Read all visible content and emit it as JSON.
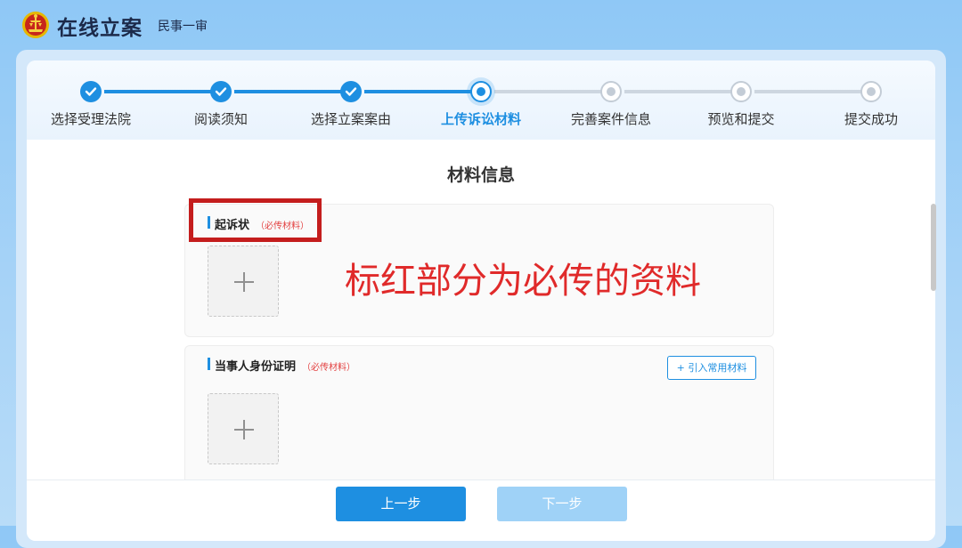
{
  "header": {
    "title": "在线立案",
    "subtitle": "民事一审",
    "emblem_icon": "court-emblem-icon"
  },
  "steps": [
    {
      "label": "选择受理法院",
      "state": "done"
    },
    {
      "label": "阅读须知",
      "state": "done"
    },
    {
      "label": "选择立案案由",
      "state": "done"
    },
    {
      "label": "上传诉讼材料",
      "state": "current"
    },
    {
      "label": "完善案件信息",
      "state": "todo"
    },
    {
      "label": "预览和提交",
      "state": "todo"
    },
    {
      "label": "提交成功",
      "state": "todo"
    }
  ],
  "section_title": "材料信息",
  "materials": [
    {
      "name": "起诉状",
      "required_tag": "（必传材料）",
      "upload_icon": "plus-icon"
    },
    {
      "name": "当事人身份证明",
      "required_tag": "（必传材料）",
      "import_button": "+ 引入常用材料",
      "upload_icon": "plus-icon"
    }
  ],
  "footer": {
    "prev_label": "上一步",
    "next_label": "下一步"
  },
  "annotation": "标红部分为必传的资料",
  "colors": {
    "accent": "#1e8fe1",
    "required": "#e34141",
    "annotation": "#e02a2a",
    "disabled_button": "#9fd2f7"
  }
}
